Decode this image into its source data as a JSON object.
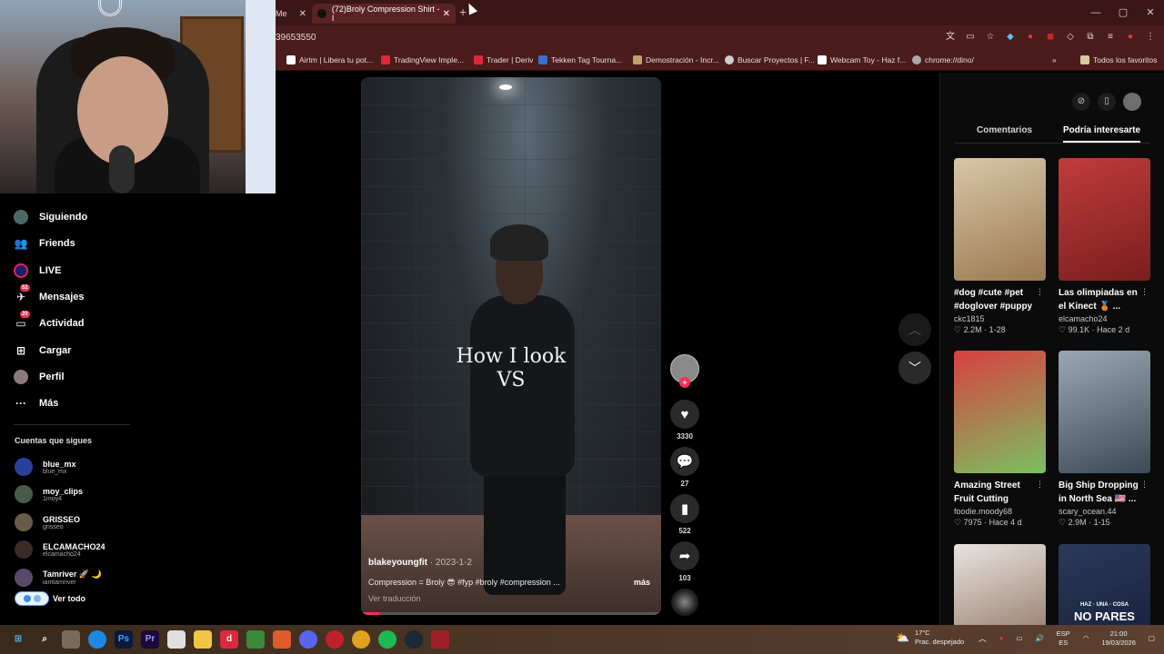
{
  "browser": {
    "tabs": [
      {
        "label": "Me"
      },
      {
        "label": "(72)Broly Compression Shirt - I"
      }
    ],
    "new_tab_label": "+",
    "window_controls": [
      "—",
      "▢",
      "✕"
    ],
    "url": "39653550",
    "bookmarks": [
      {
        "label": "Airtm | Libera tu pot...",
        "color": "#ffffff"
      },
      {
        "label": "TradingView Imple...",
        "color": "#e0283c"
      },
      {
        "label": "Trader | Deriv",
        "color": "#e0283c"
      },
      {
        "label": "Tekken Tag Tourna...",
        "color": "#3a6fd0"
      },
      {
        "label": "Demostración - Incr...",
        "color": "#c0a070"
      },
      {
        "label": "Buscar Proyectos | F...",
        "color": "#cccccc"
      },
      {
        "label": "Webcam Toy - Haz f...",
        "color": "#ffffff"
      },
      {
        "label": "chrome://dino/",
        "color": "#aaaaaa"
      }
    ],
    "all_bookmarks": "Todos los favoritos"
  },
  "sidebar": {
    "items": [
      {
        "label": "Siguiendo",
        "icon": "following-avatar-icon"
      },
      {
        "label": "Friends",
        "icon": "friends-icon"
      },
      {
        "label": "LIVE",
        "icon": "live-icon"
      },
      {
        "label": "Mensajes",
        "icon": "messages-icon",
        "badge": "52"
      },
      {
        "label": "Actividad",
        "icon": "activity-icon",
        "badge": "20"
      },
      {
        "label": "Cargar",
        "icon": "upload-icon"
      },
      {
        "label": "Perfil",
        "icon": "profile-avatar-icon"
      },
      {
        "label": "Más",
        "icon": "more-icon"
      }
    ],
    "following_title": "Cuentas que sigues",
    "accounts": [
      {
        "name": "blue_mx",
        "handle": "blue_mx",
        "color": "#2a3f9a"
      },
      {
        "name": "moy_clips",
        "handle": "1moy4",
        "color": "#4a5a4a"
      },
      {
        "name": "GRISSEO",
        "handle": "grisseo",
        "color": "#6a5a4a"
      },
      {
        "name": "ELCAMACHO24",
        "handle": "elcamacho24",
        "color": "#3a2a2a"
      },
      {
        "name": "Tamriver 🚀 🌙",
        "handle": "iamtamriver",
        "color": "#5a4a6a"
      }
    ],
    "see_all": "Ver todo"
  },
  "video": {
    "overlay_line1": "How I look",
    "overlay_line2": "VS",
    "author": "blakeyoungfit",
    "date": " · 2023-1-2",
    "description": "Compression = Broly 😎 #fyp #broly #compression ...",
    "more": "más",
    "translate": "Ver traducción",
    "progress": 0.06
  },
  "actions": {
    "follow_plus": "+",
    "likes": "3330",
    "comments": "27",
    "saves": "522",
    "shares": "103"
  },
  "right_panel": {
    "tabs": [
      "Comentarios",
      "Podría interesarte"
    ],
    "cards": [
      {
        "title": "#dog #cute #pet #doglover #puppy",
        "user": "ckc1815",
        "stats": "♡ 2.2M · 1-28",
        "colors": [
          "#d8c6a8",
          "#9a7a50"
        ]
      },
      {
        "title": "Las olimpiadas en el Kinect 🥉 ...",
        "user": "elcamacho24",
        "stats": "♡ 99.1K · Hace 2 d",
        "colors": [
          "#c03c3c",
          "#7a1e1e"
        ]
      },
      {
        "title": "Amazing Street Fruit Cutting Skill...",
        "user": "foodie.moody68",
        "stats": "♡ 7975 · Hace 4 d",
        "colors": [
          "#d84040",
          "#7ac060"
        ]
      },
      {
        "title": "Big Ship Dropping in North Sea 🇺🇸 ...",
        "user": "scary_ocean.44",
        "stats": "♡ 2.9M · 1-15",
        "colors": [
          "#9aa8b4",
          "#3c4a58"
        ]
      },
      {
        "title": "",
        "user": "",
        "stats": "",
        "colors": [
          "#e8e4e0",
          "#a08878"
        ]
      },
      {
        "title": "",
        "user": "",
        "stats": "",
        "colors": [
          "#2a3a5a",
          "#1a2440"
        ]
      }
    ],
    "last_card_caption": "NO PARES",
    "last_card_top": "HAZ · UNA · COSA"
  },
  "taskbar": {
    "weather_temp": "17°C",
    "weather_desc": "Prac. despejado",
    "lang_top": "ESP",
    "lang_bottom": "ES",
    "time": "21:00",
    "date": "19/03/2026"
  }
}
